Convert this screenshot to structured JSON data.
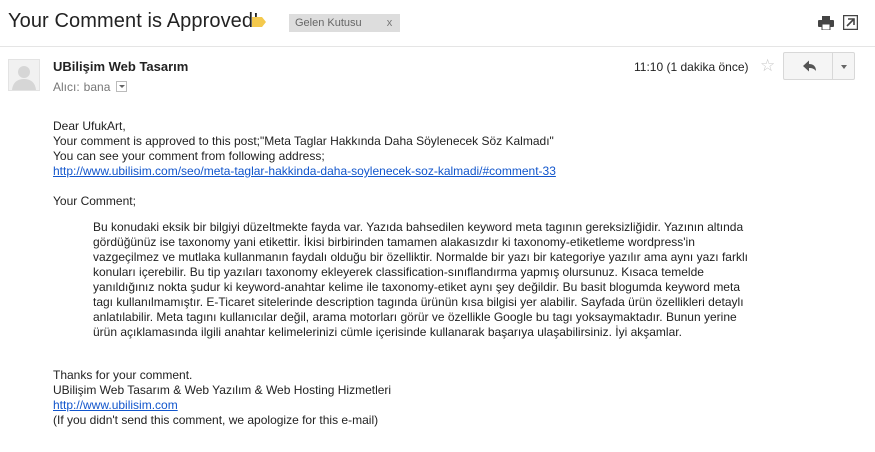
{
  "header": {
    "subject": "Your Comment is Approved!",
    "label_chip": "Gelen Kutusu",
    "label_chip_close": "x"
  },
  "message": {
    "sender": "UBilişim Web Tasarım",
    "to_label": "Alıcı:",
    "to_name": "bana",
    "time": "11:10 (1 dakika önce)",
    "star_glyph": "☆"
  },
  "body": {
    "greeting": "Dear UfukArt,",
    "approved_line": "Your comment is approved to this post;\"Meta Taglar Hakkında Daha Söylenecek Söz Kalmadı\"",
    "see_line": "You can see your comment from following address;",
    "comment_link": "http://www.ubilisim.com/seo/meta-taglar-hakkinda-daha-soylenecek-soz-kalmadi/#comment-33",
    "your_comment_label": "Your Comment;",
    "comment_lines": [
      "Bu konudaki eksik bir bilgiyi düzeltmekte fayda var. Yazıda bahsedilen keyword meta tagının gereksizliğidir. Yazının altında",
      "gördüğünüz ise taxonomy yani etikettir. İkisi birbirinden tamamen alakasızdır ki taxonomy-etiketleme wordpress'in",
      "vazgeçilmez ve mutlaka kullanmanın faydalı olduğu bir özelliktir. Normalde bir yazı bir kategoriye yazılır ama aynı yazı farklı",
      "konuları içerebilir. Bu tip yazıları taxonomy ekleyerek classification-sınıflandırma yapmış olursunuz. Kısaca temelde",
      "yanıldığınız nokta şudur ki keyword-anahtar kelime ile taxonomy-etiket aynı şey değildir. Bu basit blogumda keyword meta",
      "tagı kullanılmamıştır. E-Ticaret sitelerinde description tagında ürünün kısa bilgisi yer alabilir. Sayfada ürün özellikleri detaylı",
      "anlatılabilir. Meta tagını kullanıcılar değil, arama motorları görür ve özellikle Google bu tagı yoksaymaktadır. Bunun yerine",
      "ürün açıklamasında ilgili anahtar kelimelerinizi cümle içerisinde kullanarak başarıya ulaşabilirsiniz. İyi akşamlar."
    ],
    "thanks_line": "Thanks for your comment.",
    "signature": "UBilişim Web Tasarım & Web Yazılım & Web Hosting Hizmetleri",
    "site_link": "http://www.ubilisim.com",
    "apology": "(If you didn't send this comment, we apologize for this e-mail)"
  },
  "colors": {
    "link": "#1155cc",
    "label_tag": "#f4c94d",
    "chip_bg": "#dddddd"
  },
  "icons": {
    "print": "print-icon",
    "new_window": "new-window-icon",
    "reply": "reply-arrow-icon",
    "more": "chevron-down-icon",
    "star": "star-icon",
    "label": "label-tag-icon",
    "avatar": "default-avatar-icon"
  }
}
